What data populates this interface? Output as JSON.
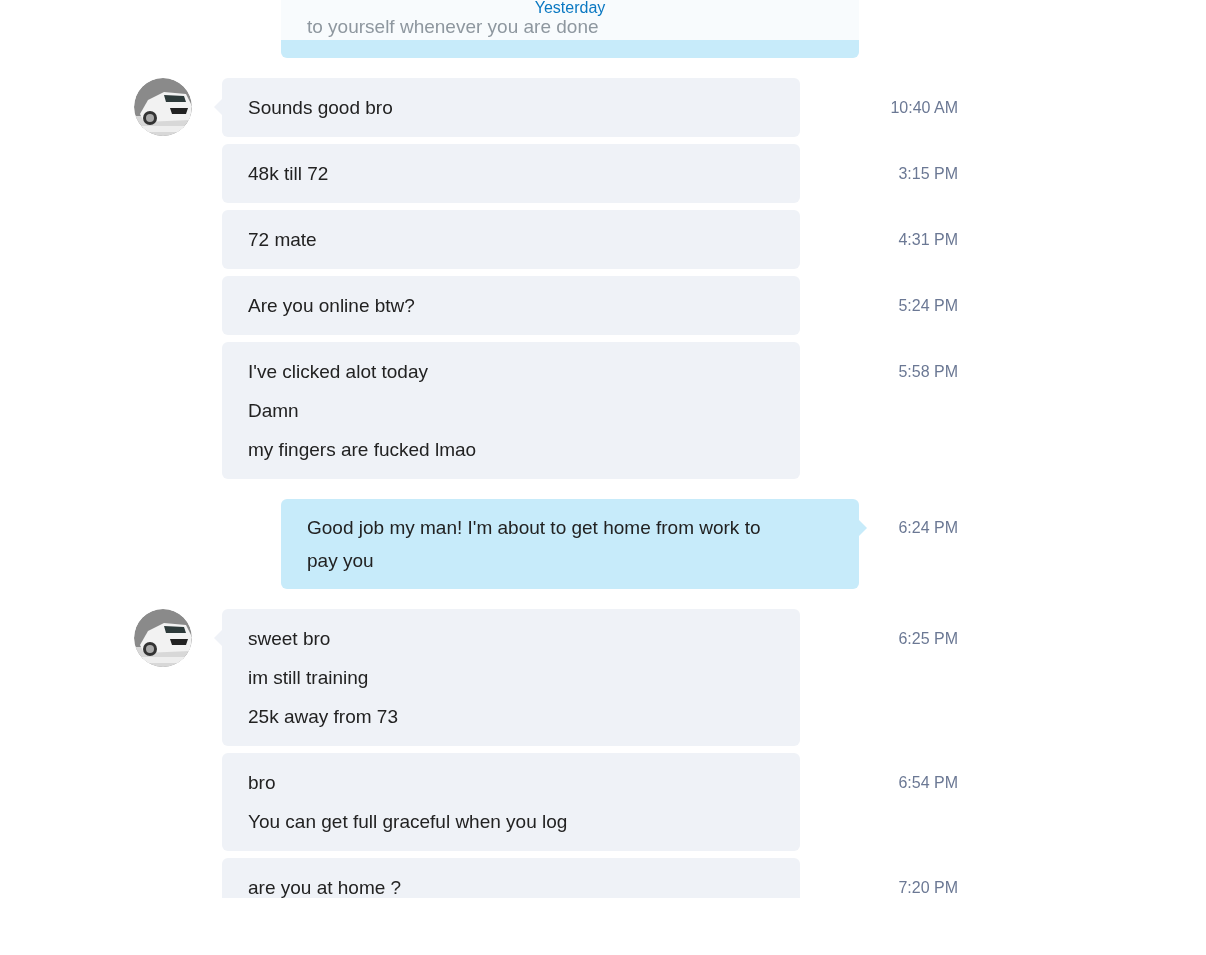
{
  "date_header": "Yesterday",
  "partial_message": {
    "kind": "outgoing",
    "text": "to yourself whenever you are done"
  },
  "groups": [
    {
      "kind": "incoming",
      "messages": [
        {
          "lines": [
            "Sounds good bro"
          ],
          "time": "10:40 AM"
        },
        {
          "lines": [
            "48k till 72"
          ],
          "time": "3:15 PM"
        },
        {
          "lines": [
            "72 mate"
          ],
          "time": "4:31 PM"
        },
        {
          "lines": [
            "Are you online btw?"
          ],
          "time": "5:24 PM"
        },
        {
          "lines": [
            "I've clicked alot today",
            "Damn",
            "my fingers are fucked lmao"
          ],
          "time": "5:58 PM"
        }
      ]
    },
    {
      "kind": "outgoing",
      "messages": [
        {
          "lines": [
            "Good job my man! I'm about to get home from work to pay you"
          ],
          "time": "6:24 PM"
        }
      ]
    },
    {
      "kind": "incoming",
      "messages": [
        {
          "lines": [
            "sweet bro",
            "im still training",
            "25k away from 73"
          ],
          "time": "6:25 PM"
        },
        {
          "lines": [
            "bro",
            "You can get full graceful when you log"
          ],
          "time": "6:54 PM"
        },
        {
          "lines": [
            "are you at home ?"
          ],
          "time": "7:20 PM"
        }
      ]
    }
  ]
}
